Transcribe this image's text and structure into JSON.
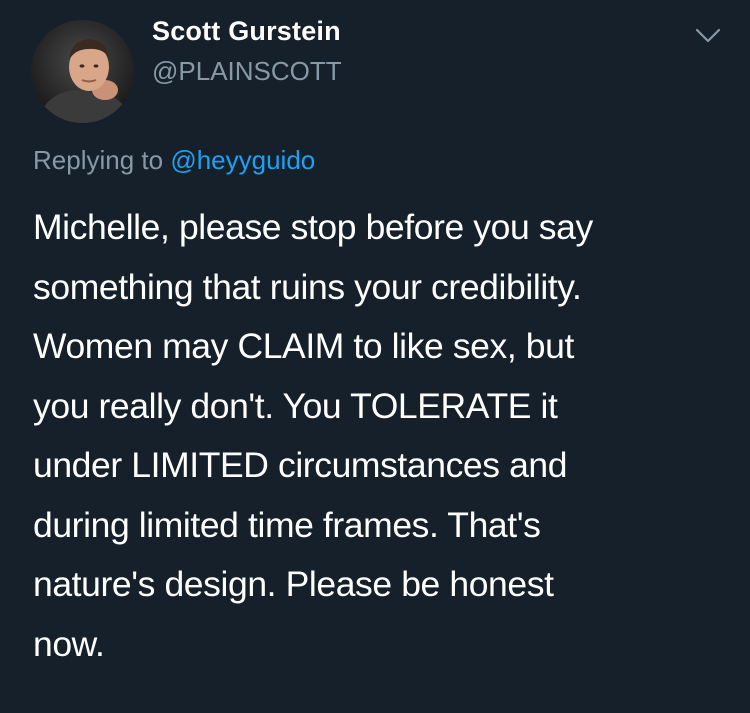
{
  "author": {
    "name": "Scott Gurstein",
    "handle": "@PLAINSCOTT",
    "avatar_icon": "user-avatar-photo"
  },
  "menu": {
    "icon": "chevron-down-icon"
  },
  "reply": {
    "prefix": "Replying to ",
    "mention": "@heyyguido"
  },
  "tweet": {
    "text": "Michelle, please stop before you say\nsomething that ruins your credibility.\nWomen may CLAIM to like sex, but\nyou really don't.  You TOLERATE it\nunder LIMITED circumstances and\nduring limited time frames.  That's\nnature's design.  Please be honest\nnow."
  },
  "colors": {
    "background": "#15202b",
    "primary_text": "#ffffff",
    "secondary_text": "#8899a6",
    "link": "#1da1f2"
  }
}
